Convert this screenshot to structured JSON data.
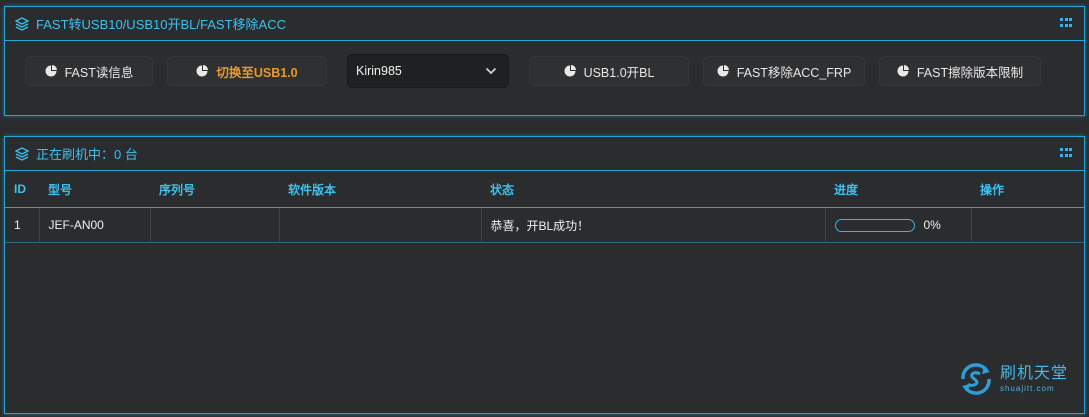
{
  "panel_top": {
    "title": "FAST转USB10/USB10开BL/FAST移除ACC"
  },
  "toolbar": {
    "read_info": "FAST读信息",
    "switch_usb": "切换至USB1.0",
    "chip_select": "Kirin985",
    "usb_unlock": "USB1.0开BL",
    "remove_acc": "FAST移除ACC_FRP",
    "erase_limit": "FAST擦除版本限制"
  },
  "panel_bottom": {
    "title": "正在刷机中：0 台"
  },
  "table": {
    "headers": [
      "ID",
      "型号",
      "序列号",
      "软件版本",
      "状态",
      "进度",
      "操作"
    ],
    "rows": [
      {
        "id": "1",
        "model": "JEF-AN00",
        "serial": "",
        "version": "",
        "status": "恭喜，开BL成功！",
        "progress": 0,
        "progress_text": "0%",
        "action": ""
      }
    ]
  },
  "watermark": {
    "cn": "刷机天堂",
    "en": "shuajitt.com"
  },
  "colors": {
    "accent": "#1fa7d6",
    "active_button": "#e89a2a",
    "background": "#2b2c2e"
  }
}
